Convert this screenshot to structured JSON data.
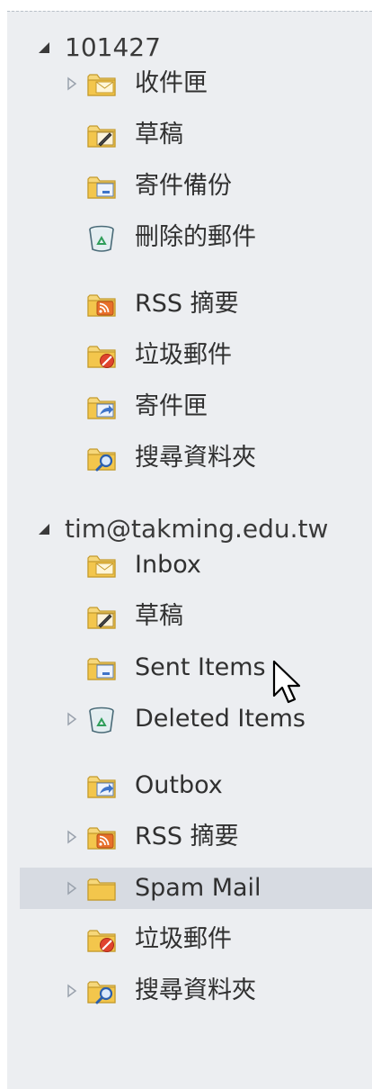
{
  "accounts": [
    {
      "label": "101427",
      "folders": [
        {
          "label": "收件匣",
          "icon": "inbox-folder-icon",
          "expandable": true
        },
        {
          "label": "草稿",
          "icon": "drafts-folder-icon",
          "expandable": false
        },
        {
          "label": "寄件備份",
          "icon": "sent-folder-icon",
          "expandable": false
        },
        {
          "label": "刪除的郵件",
          "icon": "deleted-items-icon",
          "expandable": false
        },
        {
          "label": "RSS 摘要",
          "icon": "rss-folder-icon",
          "expandable": false
        },
        {
          "label": "垃圾郵件",
          "icon": "junk-folder-icon",
          "expandable": false
        },
        {
          "label": "寄件匣",
          "icon": "outbox-folder-icon",
          "expandable": false
        },
        {
          "label": "搜尋資料夾",
          "icon": "search-folder-icon",
          "expandable": false
        }
      ]
    },
    {
      "label": "tim@takming.edu.tw",
      "folders": [
        {
          "label": "Inbox",
          "icon": "inbox-folder-icon",
          "expandable": false
        },
        {
          "label": "草稿",
          "icon": "drafts-folder-icon",
          "expandable": false
        },
        {
          "label": "Sent Items",
          "icon": "sent-folder-icon",
          "expandable": false
        },
        {
          "label": "Deleted Items",
          "icon": "deleted-items-icon",
          "expandable": true
        },
        {
          "label": "Outbox",
          "icon": "outbox-folder-icon",
          "expandable": false
        },
        {
          "label": "RSS 摘要",
          "icon": "rss-folder-icon",
          "expandable": true
        },
        {
          "label": "Spam Mail",
          "icon": "plain-folder-icon",
          "expandable": true,
          "selected": true
        },
        {
          "label": "垃圾郵件",
          "icon": "junk-folder-icon",
          "expandable": false
        },
        {
          "label": "搜尋資料夾",
          "icon": "search-folder-icon",
          "expandable": true
        }
      ]
    }
  ],
  "colors": {
    "pane_bg": "#eceef1",
    "selected_bg": "#d7dbe2",
    "folder_yellow": "#f3c64c",
    "rss_orange": "#e8702a",
    "junk_red": "#e0442e",
    "outbox_blue": "#3f74c9",
    "trash_green": "#2f9e5a"
  }
}
